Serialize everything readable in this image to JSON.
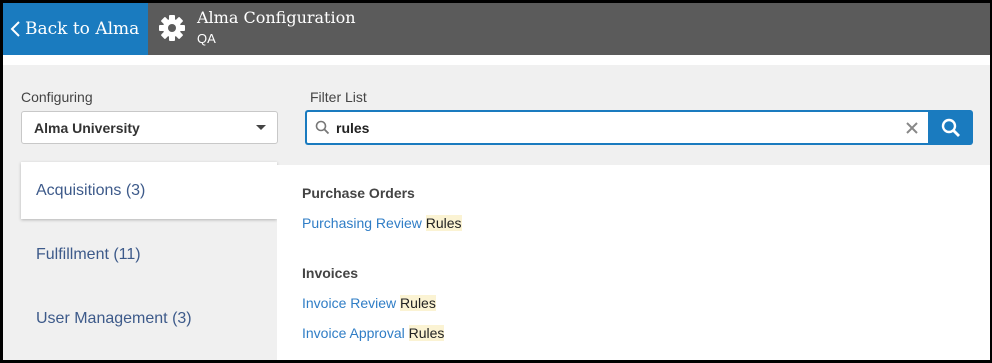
{
  "header": {
    "back_label": "Back to Alma",
    "title": "Alma Configuration",
    "subtitle": "QA"
  },
  "configuring": {
    "label": "Configuring",
    "selected": "Alma University"
  },
  "filter": {
    "label": "Filter List",
    "value": "rules"
  },
  "nav": {
    "items": [
      {
        "label": "Acquisitions (3)",
        "active": true
      },
      {
        "label": "Fulfillment (11)",
        "active": false
      },
      {
        "label": "User Management (3)",
        "active": false
      }
    ]
  },
  "results": {
    "sections": [
      {
        "title": "Purchase Orders",
        "links": [
          {
            "text": "Purchasing Review ",
            "match": "Rules"
          }
        ]
      },
      {
        "title": "Invoices",
        "links": [
          {
            "text": "Invoice Review ",
            "match": "Rules"
          },
          {
            "text": "Invoice Approval ",
            "match": "Rules"
          }
        ]
      }
    ]
  },
  "colors": {
    "accent": "#1a7bbf",
    "header_bg": "#5b5b5b",
    "panel_bg": "#f0f0f0",
    "link": "#2f7dc6",
    "highlight": "#fbf3d3"
  },
  "icons": {
    "back": "chevron-left-icon",
    "app": "gear-icon",
    "search": "magnifier-icon",
    "clear": "close-icon",
    "dropdown": "caret-down-icon"
  }
}
